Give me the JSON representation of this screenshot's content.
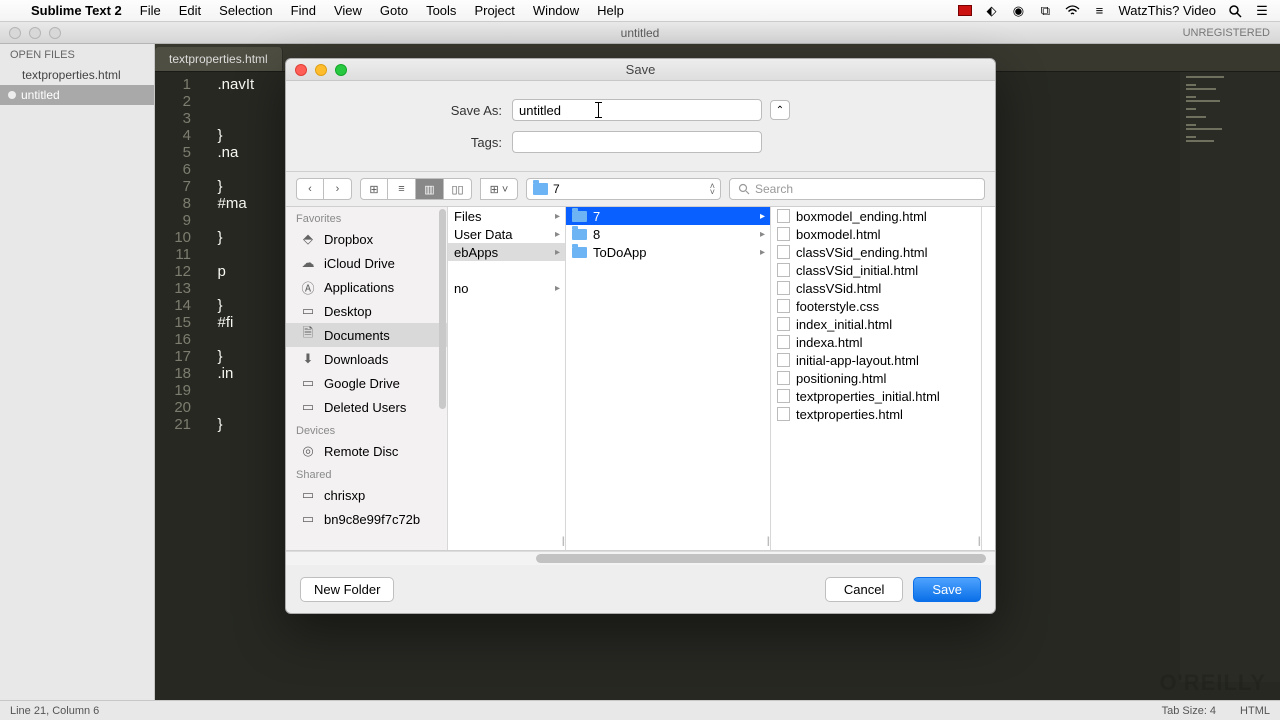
{
  "menubar": {
    "app": "Sublime Text 2",
    "items": [
      "File",
      "Edit",
      "Selection",
      "Find",
      "View",
      "Goto",
      "Tools",
      "Project",
      "Window",
      "Help"
    ],
    "right_label": "WatzThis? Video"
  },
  "window": {
    "title": "untitled",
    "unregistered": "UNREGISTERED"
  },
  "sidebar": {
    "header": "OPEN FILES",
    "files": [
      "textproperties.html",
      "untitled"
    ]
  },
  "tabs": [
    "textproperties.html"
  ],
  "code_lines": [
    ".navIt",
    "",
    "",
    "}",
    ".na",
    "",
    "}",
    "#ma",
    "",
    "}",
    "",
    "p ",
    "",
    "}",
    "#fi",
    "",
    "}",
    ".in",
    "",
    "",
    "}"
  ],
  "dialog": {
    "title": "Save",
    "saveas_label": "Save As:",
    "saveas_value": "untitled",
    "tags_label": "Tags:",
    "tags_value": "",
    "path_label": "7",
    "search_placeholder": "Search",
    "favorites_header": "Favorites",
    "favorites": [
      "Dropbox",
      "iCloud Drive",
      "Applications",
      "Desktop",
      "Documents",
      "Downloads",
      "Google Drive",
      "Deleted Users"
    ],
    "devices_header": "Devices",
    "devices": [
      "Remote Disc"
    ],
    "shared_header": "Shared",
    "shared": [
      "chrisxp",
      "bn9c8e99f7c72b"
    ],
    "col1": [
      "Files",
      "User Data",
      "ebApps",
      "",
      "no"
    ],
    "col2": [
      "7",
      "8",
      "ToDoApp"
    ],
    "col3": [
      "boxmodel_ending.html",
      "boxmodel.html",
      "classVSid_ending.html",
      "classVSid_initial.html",
      "classVSid.html",
      "footerstyle.css",
      "index_initial.html",
      "indexa.html",
      "initial-app-layout.html",
      "positioning.html",
      "textproperties_initial.html",
      "textproperties.html"
    ],
    "new_folder": "New Folder",
    "cancel": "Cancel",
    "save": "Save"
  },
  "status": {
    "left": "Line 21, Column 6",
    "tabsize": "Tab Size: 4",
    "lang": "HTML"
  },
  "watermark": "O'REILLY"
}
